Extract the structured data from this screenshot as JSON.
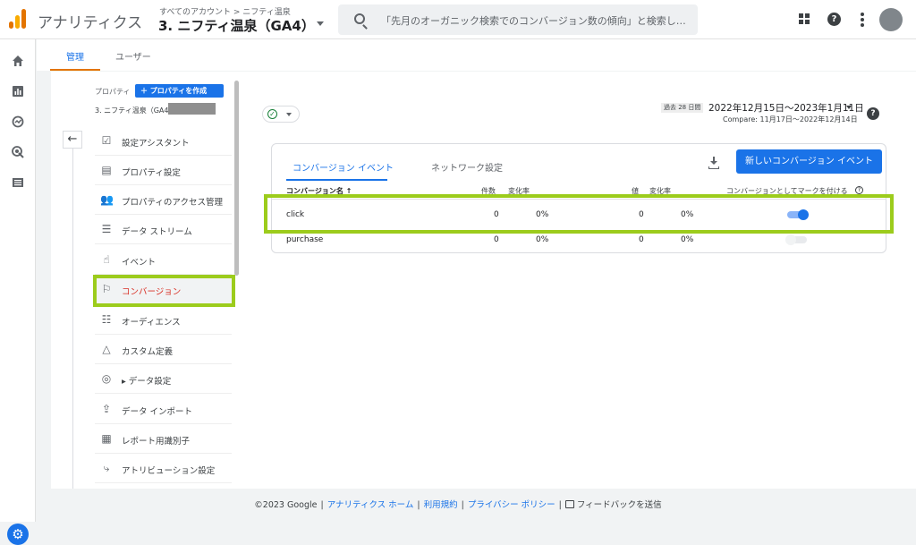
{
  "header": {
    "app_title": "アナリティクス",
    "breadcrumb": "すべてのアカウント > ニフティ温泉",
    "property_name": "3. ニフティ温泉（GA4）",
    "search_placeholder": "「先月のオーガニック検索でのコンバージョン数の傾向」と検索し…"
  },
  "top_tabs": [
    {
      "label": "管理"
    },
    {
      "label": "ユーザー"
    }
  ],
  "property_panel": {
    "label": "プロパティ",
    "create_button": "＋ プロパティを作成",
    "property_sub": "3. ニフティ温泉（GA4）"
  },
  "sidebar": {
    "items": [
      {
        "label": "設定アシスタント",
        "icon": "checklist-icon"
      },
      {
        "label": "プロパティ設定",
        "icon": "layout-icon"
      },
      {
        "label": "プロパティのアクセス管理",
        "icon": "people-icon"
      },
      {
        "label": "データ ストリーム",
        "icon": "stream-icon"
      },
      {
        "label": "イベント",
        "icon": "touch-icon"
      },
      {
        "label": "コンバージョン",
        "icon": "flag-icon"
      },
      {
        "label": "オーディエンス",
        "icon": "audience-icon"
      },
      {
        "label": "カスタム定義",
        "icon": "shapes-icon"
      },
      {
        "label": "▸ データ設定",
        "icon": "database-icon"
      },
      {
        "label": "データ インポート",
        "icon": "upload-icon"
      },
      {
        "label": "レポート用識別子",
        "icon": "id-icon"
      },
      {
        "label": "アトリビューション設定",
        "icon": "attribution-icon"
      }
    ]
  },
  "date": {
    "badge": "過去 28 日間",
    "range": "2022年12月15日～2023年1月11日",
    "compare": "Compare: 11月17日～2022年12月14日"
  },
  "conversions": {
    "tabs": [
      {
        "label": "コンバージョン イベント"
      },
      {
        "label": "ネットワーク設定"
      }
    ],
    "new_button": "新しいコンバージョン イベント",
    "columns": {
      "name": "コンバージョン名 ↑",
      "count": "件数",
      "count_change": "変化率",
      "value": "値",
      "value_change": "変化率",
      "mark": "コンバージョンとしてマークを付ける"
    },
    "rows": [
      {
        "name": "click",
        "count": "0",
        "count_change": "0%",
        "value": "0",
        "value_change": "0%",
        "marked": true
      },
      {
        "name": "purchase",
        "count": "0",
        "count_change": "0%",
        "value": "0",
        "value_change": "0%",
        "marked": false
      }
    ]
  },
  "footer": {
    "copyright": "©2023 Google",
    "link_home": "アナリティクス ホーム",
    "link_terms": "利用規約",
    "link_privacy": "プライバシー ポリシー",
    "feedback": "フィードバックを送信"
  },
  "colors": {
    "accent": "#1a73e8",
    "highlight": "#9ccc1c",
    "active_nav_text": "#d93025",
    "tab_indicator": "#e37400"
  }
}
